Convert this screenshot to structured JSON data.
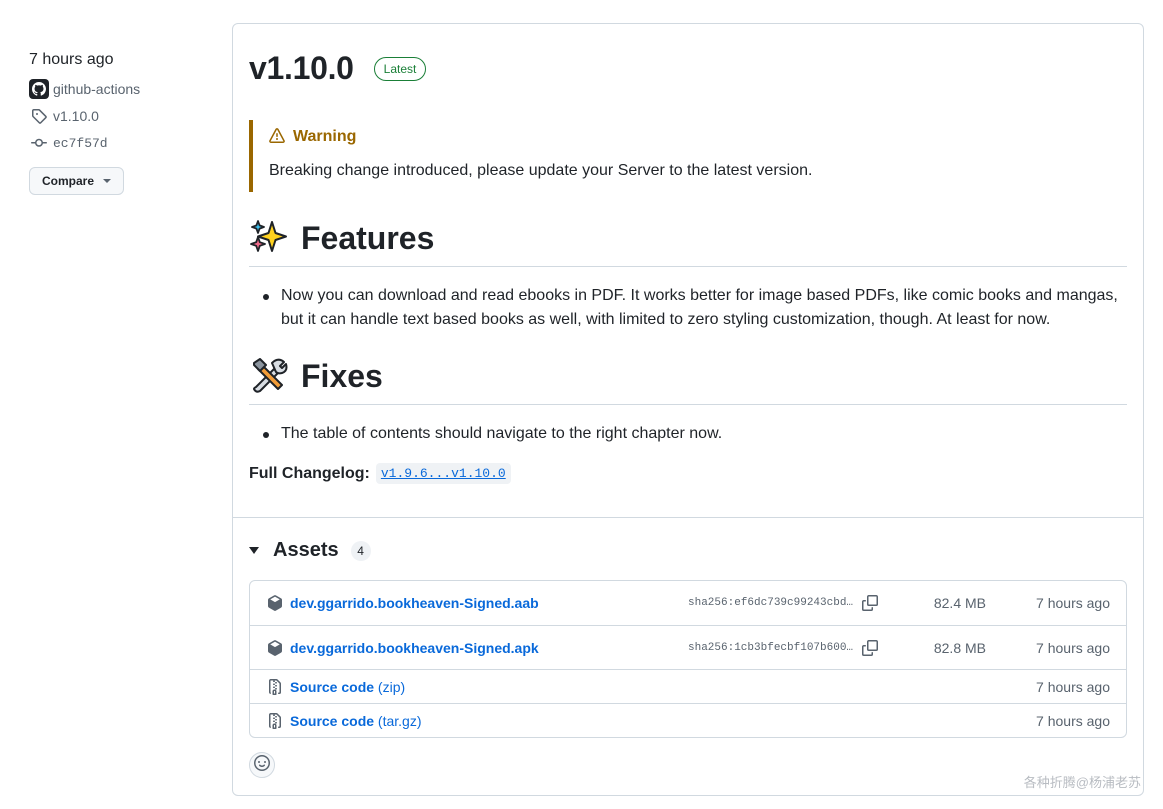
{
  "sidebar": {
    "time": "7 hours ago",
    "author": "github-actions",
    "tag": "v1.10.0",
    "commit": "ec7f57d",
    "compare_label": "Compare"
  },
  "release": {
    "title": "v1.10.0",
    "badge": "Latest",
    "warning": {
      "title": "Warning",
      "text": "Breaking change introduced, please update your Server to the latest version."
    },
    "features": {
      "heading": "Features",
      "items": [
        "Now you can download and read ebooks in PDF. It works better for image based PDFs, like comic books and mangas, but it can handle text based books as well, with limited to zero styling customization, though. At least for now."
      ]
    },
    "fixes": {
      "heading": "Fixes",
      "items": [
        "The table of contents should navigate to the right chapter now."
      ]
    },
    "changelog": {
      "label": "Full Changelog",
      "link": "v1.9.6...v1.10.0"
    }
  },
  "assets": {
    "heading": "Assets",
    "count": "4",
    "items": [
      {
        "name": "dev.ggarrido.bookheaven-Signed.aab",
        "sha": "sha256:ef6dc739c99243cbd…",
        "size": "82.4 MB",
        "time": "7 hours ago",
        "icon": "package-icon"
      },
      {
        "name": "dev.ggarrido.bookheaven-Signed.apk",
        "sha": "sha256:1cb3bfecbf107b600…",
        "size": "82.8 MB",
        "time": "7 hours ago",
        "icon": "package-icon"
      },
      {
        "name": "Source code",
        "suffix": "(zip)",
        "time": "7 hours ago",
        "icon": "file-zip-icon"
      },
      {
        "name": "Source code",
        "suffix": "(tar.gz)",
        "time": "7 hours ago",
        "icon": "file-zip-icon"
      }
    ]
  },
  "watermark": "各种折腾@杨浦老苏",
  "colors": {
    "accent": "#0969da",
    "latest": "#1a7f37",
    "warning": "#9a6700",
    "border": "#d1d9e0"
  }
}
